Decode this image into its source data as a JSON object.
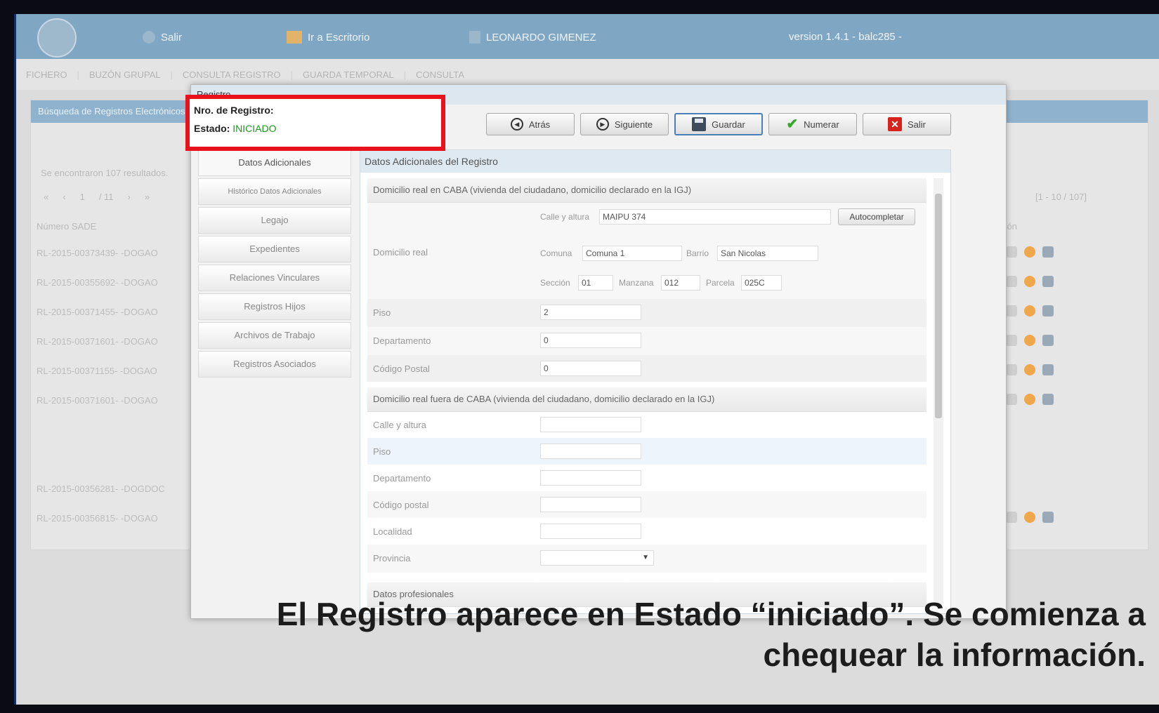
{
  "topbar": {
    "salir": "Salir",
    "escritorio": "Ir a Escritorio",
    "user": "LEONARDO GIMENEZ",
    "version": "version 1.4.1 - balc285 -"
  },
  "menu": [
    "FICHERO",
    "BUZÓN GRUPAL",
    "CONSULTA REGISTRO",
    "GUARDA TEMPORAL",
    "CONSULTA"
  ],
  "background": {
    "panel_title": "Búsqueda de Registros Electrónicos",
    "results_text": "Se encontraron 107 resultados.",
    "pager": [
      "«",
      "‹",
      "1",
      "/ 11",
      "›",
      "»"
    ],
    "range": "[1 - 10 / 107]",
    "col_numero": "Número SADE",
    "col_accion": "Acción",
    "rows": [
      "RL-2015-00373439- -DOGAO",
      "RL-2015-00355692- -DOGAO",
      "RL-2015-00371455- -DOGAO",
      "RL-2015-00371601- -DOGAO",
      "RL-2015-00371155- -DOGAO",
      "RL-2015-00371601- -DOGAO",
      "",
      "",
      "RL-2015-00356281- -DOGDOC",
      "RL-2015-00356815- -DOGAO"
    ]
  },
  "dialog": {
    "title": "Registro",
    "nro_label": "Nro. de Registro:",
    "estado_label": "Estado:",
    "estado_value": "INICIADO",
    "buttons": {
      "atras": "Atrás",
      "siguiente": "Siguiente",
      "guardar": "Guardar",
      "numerar": "Numerar",
      "salir": "Salir"
    },
    "nav": [
      "Datos Adicionales",
      "Histórico Datos Adicionales",
      "Legajo",
      "Expedientes",
      "Relaciones Vinculares",
      "Registros Hijos",
      "Archivos de Trabajo",
      "Registros Asociados"
    ],
    "content_title": "Datos Adicionales del Registro",
    "section1": {
      "title": "Domicilio real en CABA (vivienda del ciudadano, domicilio declarado en la IGJ)",
      "calle_label": "Calle y altura",
      "calle_value": "MAIPU 374",
      "autocompletar": "Autocompletar",
      "domicilio_label": "Domicilio real",
      "comuna_label": "Comuna",
      "comuna_value": "Comuna 1",
      "barrio_label": "Barrio",
      "barrio_value": "San Nicolas",
      "seccion_label": "Sección",
      "seccion_value": "01",
      "manzana_label": "Manzana",
      "manzana_value": "012",
      "parcela_label": "Parcela",
      "parcela_value": "025C",
      "piso_label": "Piso",
      "piso_value": "2",
      "depto_label": "Departamento",
      "depto_value": "0",
      "cp_label": "Código Postal",
      "cp_value": "0"
    },
    "section2": {
      "title": "Domicilio real fuera de CABA (vivienda del ciudadano, domicilio declarado en la IGJ)",
      "labels": [
        "Calle y altura",
        "Piso",
        "Departamento",
        "Código postal",
        "Localidad",
        "Provincia"
      ]
    },
    "section3_title": "Datos profesionales"
  },
  "caption": {
    "line1": "El Registro aparece en Estado “iniciado”. Se comienza a",
    "line2": "chequear la información."
  },
  "colors": {
    "topbar": "#7fa6c3",
    "highlight": "#e8121c",
    "estado": "#1c9a1c"
  }
}
